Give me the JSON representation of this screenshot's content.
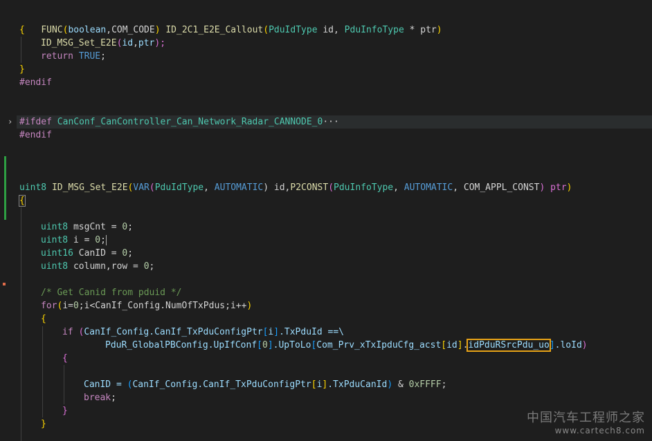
{
  "editor": {
    "fold_marker": "›",
    "watermark_line1": "中国汽车工程师之家",
    "watermark_line2": "www.cartech8.com",
    "lines": {
      "l1": {
        "a": "FUNC",
        "b": "(",
        "c": "boolean",
        "d": ",",
        "e": "COM_CODE",
        "f": ")",
        "g": " ID_2C1_E2E_Callout",
        "h": "(",
        "i": "PduIdType",
        "j": " id, ",
        "k": "PduInfoType",
        "l": " * ptr",
        ",m": ")"
      },
      "l1m": ")",
      "l2": "{",
      "l3a": "ID_MSG_Set_E2E",
      "l3b": "(",
      "l3c": "id",
      "l3d": ",",
      "l3e": "ptr",
      "l3f": ");",
      "l4a": "return",
      "l4b": " TRUE",
      "l4c": ";",
      "l5": "}",
      "l6": "#endif",
      "l7a": "#ifdef",
      "l7b": " CanConf_CanController_Can_Network_Radar_CANNODE_0",
      "l7c": "···",
      "l8": "#endif",
      "l9a": "uint8",
      "l9b": " ID_MSG_Set_E2E",
      "l9c": "(",
      "l9d": "VAR",
      "l9e": "(",
      "l9f": "PduIdType",
      "l9g": ", ",
      "l9h": "AUTOMATIC",
      "l9i": ") id,",
      "l9j": "P2CONST",
      "l9k": "(",
      "l9l": "PduInfoType",
      "l9m": ", ",
      "l9n": "AUTOMATIC",
      "l9o": ", COM_APPL_CONST",
      "l9p": ") ptr",
      "l9q": ")",
      "l10": "{",
      "l11a": "uint8",
      "l11b": " msgCnt = ",
      "l11c": "0",
      "l11d": ";",
      "l12a": "uint8",
      "l12b": " i = ",
      "l12c": "0",
      "l12d": ";",
      "l13a": "uint16",
      "l13b": " CanID = ",
      "l13c": "0",
      "l13d": ";",
      "l14a": "uint8",
      "l14b": " column,row = ",
      "l14c": "0",
      "l14d": ";",
      "l15": "/* Get Canid from pduid */",
      "l16a": "for",
      "l16b": "(",
      "l16c": "i=",
      "l16d": "0",
      "l16e": ";i<CanIf_Config.NumOfTxPdus;i++",
      "l16f": ")",
      "l17": "{",
      "l18a": "if",
      "l18b": " (",
      "l18c": "CanIf_Config.CanIf_TxPduConfigPtr",
      "l18d": "[",
      "l18e": "i",
      "l18f": "]",
      "l18g": ".TxPduId ==\\",
      "l19a": "PduR_GlobalPBConfig.UpIfConf",
      "l19b": "[",
      "l19c": "0",
      "l19d": "]",
      "l19e": ".UpToLo",
      "l19f": "[",
      "l19g": "Com_Prv_xTxIpduCfg_acst",
      "l19h": "[",
      "l19i": "id",
      "l19j": "]",
      "l19k": ".",
      "l19l": "idPduRSrcPdu_uo",
      "l19m": "]",
      "l19n": ".loId",
      "l19o": ")",
      "l20": "{",
      "l21a": "CanID = ",
      "l21b": "(",
      "l21c": "CanIf_Config.CanIf_TxPduConfigPtr",
      "l21d": "[",
      "l21e": "i",
      "l21f": "]",
      "l21g": ".TxPduCanId",
      "l21h": ")",
      "l21i": " & ",
      "l21j": "0xFFFF",
      "l21k": ";",
      "l22a": "break",
      "l22b": ";",
      "l23": "}",
      "l24": "}"
    }
  }
}
